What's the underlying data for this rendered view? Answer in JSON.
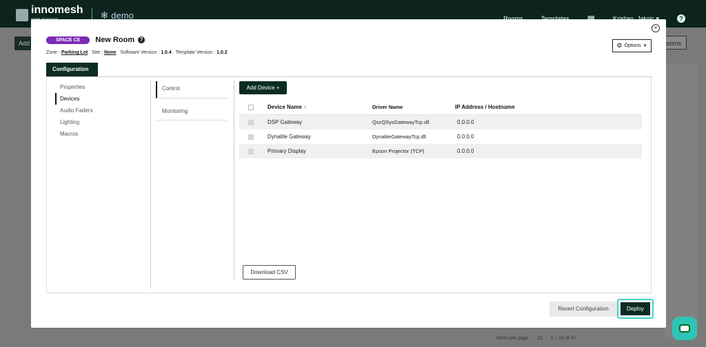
{
  "app": {
    "brand": "innomesh",
    "brand_sub": "room manager",
    "tenant": "demo",
    "nav": {
      "rooms": "Rooms",
      "templates": "Templates",
      "user": "Kristian_Jaksic ▾"
    }
  },
  "background": {
    "add_label": "Add",
    "rooms_label": "rooms",
    "items_per_page_label": "Items per page",
    "items_per_page": "15",
    "range": "1 – 15 of 47"
  },
  "modal": {
    "badge": "SPACE CE",
    "title": "New Room",
    "meta": {
      "zone_label": "Zone :",
      "zone": "Parking Lot",
      "site_label": "Site :",
      "site": "None",
      "software_label": "Software Version :",
      "software": "1.0.4",
      "template_label": "Template Version :",
      "template": "1.0.2"
    },
    "options_label": "Options",
    "tab_label": "Configuration",
    "side_menu": [
      "Properties",
      "Devices",
      "Audio Faders",
      "Lighting",
      "Macros"
    ],
    "sub_menu": [
      "Control",
      "Monitoring"
    ],
    "add_device_label": "Add Device +",
    "columns": {
      "name": "Device Name",
      "driver": "Driver Name",
      "ip": "IP Address / Hostname"
    },
    "devices": [
      {
        "name": "DSP Gateway",
        "driver": "QscQSysGatewayTcp.dll",
        "ip": "0.0.0.0"
      },
      {
        "name": "Dynalite Gateway",
        "driver": "DynaliteGatewayTcp.dll",
        "ip": "0.0.0.0"
      },
      {
        "name": "Primary Display",
        "driver": "Epson Projector (TCP)",
        "ip": "0.0.0.0"
      }
    ],
    "download_csv_label": "Download CSV",
    "revert_label": "Revert Configuration",
    "deploy_label": "Deploy"
  },
  "colors": {
    "brand_dark": "#0c2d24",
    "badge_purple": "#7b2ab9",
    "highlight_teal": "#3fd2c7",
    "chat_teal": "#2ec4b6"
  }
}
